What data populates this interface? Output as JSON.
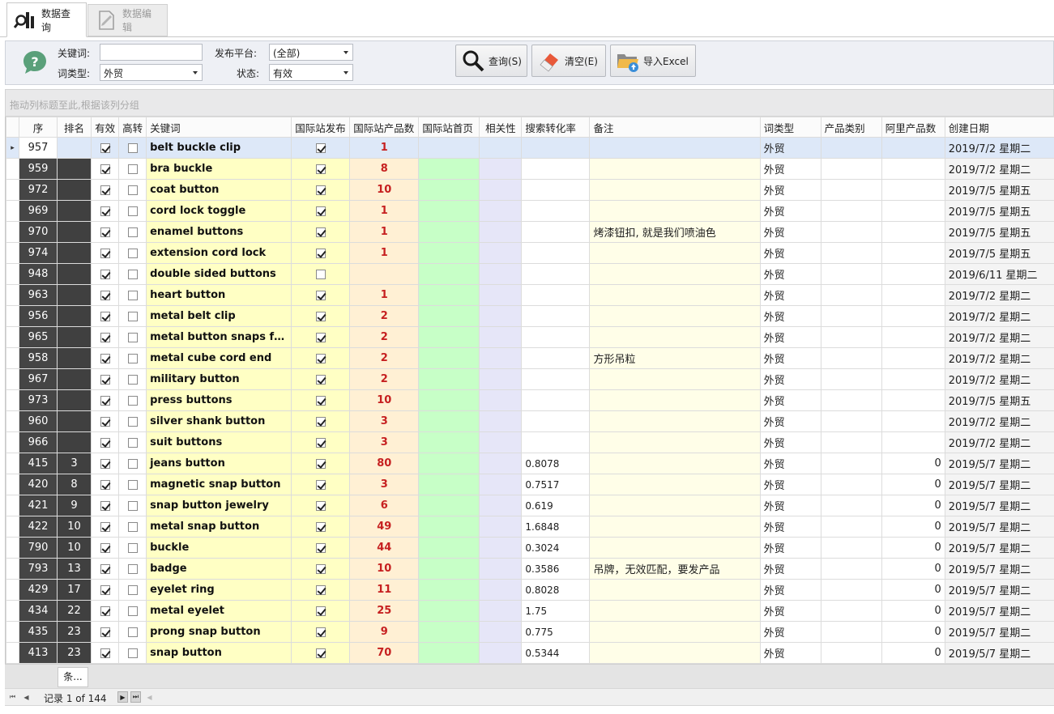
{
  "tabs": [
    {
      "label": "数据查询",
      "icon": "search-data-icon"
    },
    {
      "label": "数据编辑",
      "icon": "edit-document-icon"
    }
  ],
  "filter": {
    "keyword_label": "关键词:",
    "keyword_value": "",
    "word_type_label": "词类型:",
    "word_type_value": "外贸",
    "platform_label": "发布平台:",
    "platform_value": "(全部)",
    "status_label": "状态:",
    "status_value": "有效"
  },
  "buttons": {
    "query": "查询(S)",
    "clear": "清空(E)",
    "import": "导入Excel"
  },
  "group_panel_hint": "拖动列标题至此,根据该列分组",
  "columns": [
    "序",
    "排名",
    "有效",
    "高转",
    "关键词",
    "国际站发布",
    "国际站产品数",
    "国际站首页",
    "相关性",
    "搜索转化率",
    "备注",
    "词类型",
    "产品类别",
    "阿里产品数",
    "创建日期"
  ],
  "rows": [
    {
      "seq": "957",
      "rank": "",
      "valid": true,
      "hi": false,
      "kw": "belt buckle clip",
      "pub": true,
      "cnt": "1",
      "conv": "",
      "note": "",
      "wtype": "外贸",
      "ali": "",
      "date": "2019/7/2 星期二",
      "selected": true
    },
    {
      "seq": "959",
      "rank": "",
      "valid": true,
      "hi": false,
      "kw": "bra buckle",
      "pub": true,
      "cnt": "8",
      "conv": "",
      "note": "",
      "wtype": "外贸",
      "ali": "",
      "date": "2019/7/2 星期二"
    },
    {
      "seq": "972",
      "rank": "",
      "valid": true,
      "hi": false,
      "kw": "coat button",
      "pub": true,
      "cnt": "10",
      "conv": "",
      "note": "",
      "wtype": "外贸",
      "ali": "",
      "date": "2019/7/5 星期五"
    },
    {
      "seq": "969",
      "rank": "",
      "valid": true,
      "hi": false,
      "kw": "cord lock toggle",
      "pub": true,
      "cnt": "1",
      "conv": "",
      "note": "",
      "wtype": "外贸",
      "ali": "",
      "date": "2019/7/5 星期五"
    },
    {
      "seq": "970",
      "rank": "",
      "valid": true,
      "hi": false,
      "kw": "enamel buttons",
      "pub": true,
      "cnt": "1",
      "conv": "",
      "note": "烤漆钮扣, 就是我们喷油色",
      "wtype": "外贸",
      "ali": "",
      "date": "2019/7/5 星期五"
    },
    {
      "seq": "974",
      "rank": "",
      "valid": true,
      "hi": false,
      "kw": "extension cord lock",
      "pub": true,
      "cnt": "1",
      "conv": "",
      "note": "",
      "wtype": "外贸",
      "ali": "",
      "date": "2019/7/5 星期五"
    },
    {
      "seq": "948",
      "rank": "",
      "valid": true,
      "hi": false,
      "kw": "double sided buttons",
      "pub": false,
      "cnt": "",
      "conv": "",
      "note": "",
      "wtype": "外贸",
      "ali": "",
      "date": "2019/6/11 星期二"
    },
    {
      "seq": "963",
      "rank": "",
      "valid": true,
      "hi": false,
      "kw": "heart button",
      "pub": true,
      "cnt": "1",
      "conv": "",
      "note": "",
      "wtype": "外贸",
      "ali": "",
      "date": "2019/7/2 星期二"
    },
    {
      "seq": "956",
      "rank": "",
      "valid": true,
      "hi": false,
      "kw": "metal belt clip",
      "pub": true,
      "cnt": "2",
      "conv": "",
      "note": "",
      "wtype": "外贸",
      "ali": "",
      "date": "2019/7/2 星期二"
    },
    {
      "seq": "965",
      "rank": "",
      "valid": true,
      "hi": false,
      "kw": "metal button snaps for l...",
      "pub": true,
      "cnt": "2",
      "conv": "",
      "note": "",
      "wtype": "外贸",
      "ali": "",
      "date": "2019/7/2 星期二"
    },
    {
      "seq": "958",
      "rank": "",
      "valid": true,
      "hi": false,
      "kw": "metal cube cord end",
      "pub": true,
      "cnt": "2",
      "conv": "",
      "note": "方形吊粒",
      "wtype": "外贸",
      "ali": "",
      "date": "2019/7/2 星期二"
    },
    {
      "seq": "967",
      "rank": "",
      "valid": true,
      "hi": false,
      "kw": "military button",
      "pub": true,
      "cnt": "2",
      "conv": "",
      "note": "",
      "wtype": "外贸",
      "ali": "",
      "date": "2019/7/2 星期二"
    },
    {
      "seq": "973",
      "rank": "",
      "valid": true,
      "hi": false,
      "kw": "press buttons",
      "pub": true,
      "cnt": "10",
      "conv": "",
      "note": "",
      "wtype": "外贸",
      "ali": "",
      "date": "2019/7/5 星期五"
    },
    {
      "seq": "960",
      "rank": "",
      "valid": true,
      "hi": false,
      "kw": "silver shank button",
      "pub": true,
      "cnt": "3",
      "conv": "",
      "note": "",
      "wtype": "外贸",
      "ali": "",
      "date": "2019/7/2 星期二"
    },
    {
      "seq": "966",
      "rank": "",
      "valid": true,
      "hi": false,
      "kw": "suit buttons",
      "pub": true,
      "cnt": "3",
      "conv": "",
      "note": "",
      "wtype": "外贸",
      "ali": "",
      "date": "2019/7/2 星期二"
    },
    {
      "seq": "415",
      "rank": "3",
      "valid": true,
      "hi": false,
      "kw": "jeans button",
      "pub": true,
      "cnt": "80",
      "conv": "0.8078",
      "note": "",
      "wtype": "外贸",
      "ali": "0",
      "date": "2019/5/7 星期二"
    },
    {
      "seq": "420",
      "rank": "8",
      "valid": true,
      "hi": false,
      "kw": "magnetic snap button",
      "pub": true,
      "cnt": "3",
      "conv": "0.7517",
      "note": "",
      "wtype": "外贸",
      "ali": "0",
      "date": "2019/5/7 星期二"
    },
    {
      "seq": "421",
      "rank": "9",
      "valid": true,
      "hi": false,
      "kw": "snap button jewelry",
      "pub": true,
      "cnt": "6",
      "conv": "0.619",
      "note": "",
      "wtype": "外贸",
      "ali": "0",
      "date": "2019/5/7 星期二"
    },
    {
      "seq": "422",
      "rank": "10",
      "valid": true,
      "hi": false,
      "kw": "metal snap button",
      "pub": true,
      "cnt": "49",
      "conv": "1.6848",
      "note": "",
      "wtype": "外贸",
      "ali": "0",
      "date": "2019/5/7 星期二"
    },
    {
      "seq": "790",
      "rank": "10",
      "valid": true,
      "hi": false,
      "kw": "buckle",
      "pub": true,
      "cnt": "44",
      "conv": "0.3024",
      "note": "",
      "wtype": "外贸",
      "ali": "0",
      "date": "2019/5/7 星期二"
    },
    {
      "seq": "793",
      "rank": "13",
      "valid": true,
      "hi": false,
      "kw": "badge",
      "pub": true,
      "cnt": "10",
      "conv": "0.3586",
      "note": "吊牌，无效匹配，要发产品",
      "wtype": "外贸",
      "ali": "0",
      "date": "2019/5/7 星期二"
    },
    {
      "seq": "429",
      "rank": "17",
      "valid": true,
      "hi": false,
      "kw": "eyelet ring",
      "pub": true,
      "cnt": "11",
      "conv": "0.8028",
      "note": "",
      "wtype": "外贸",
      "ali": "0",
      "date": "2019/5/7 星期二"
    },
    {
      "seq": "434",
      "rank": "22",
      "valid": true,
      "hi": false,
      "kw": "metal eyelet",
      "pub": true,
      "cnt": "25",
      "conv": "1.75",
      "note": "",
      "wtype": "外贸",
      "ali": "0",
      "date": "2019/5/7 星期二"
    },
    {
      "seq": "435",
      "rank": "23",
      "valid": true,
      "hi": false,
      "kw": "prong snap button",
      "pub": true,
      "cnt": "9",
      "conv": "0.775",
      "note": "",
      "wtype": "外贸",
      "ali": "0",
      "date": "2019/5/7 星期二"
    },
    {
      "seq": "413",
      "rank": "23",
      "valid": true,
      "hi": false,
      "kw": "snap button",
      "pub": true,
      "cnt": "70",
      "conv": "0.5344",
      "note": "",
      "wtype": "外贸",
      "ali": "0",
      "date": "2019/5/7 星期二"
    }
  ],
  "footer": {
    "summary_cell": "条..."
  },
  "navigator": {
    "record_text": "记录 1 of 144"
  }
}
